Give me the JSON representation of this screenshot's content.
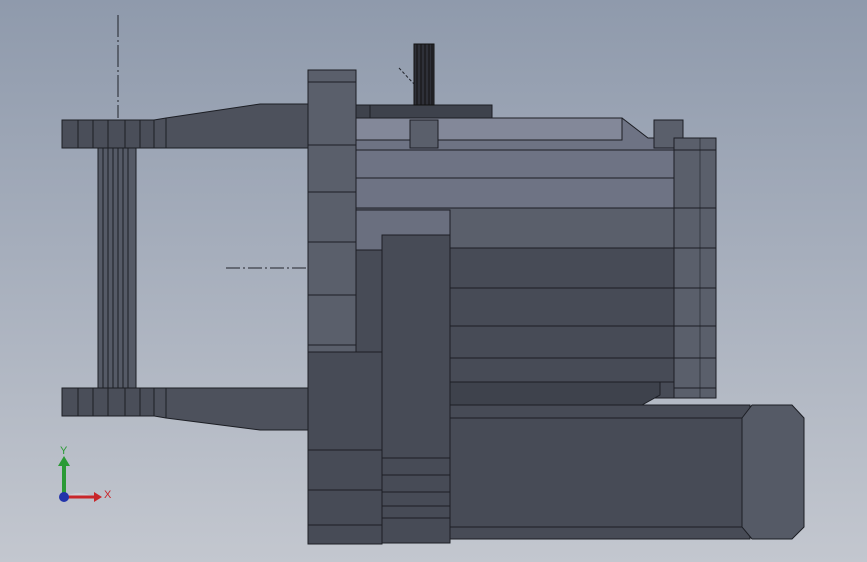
{
  "viewport": {
    "background_top": "#8f9aac",
    "background_bottom": "#c3c7cf"
  },
  "model": {
    "dark_color": "#474b56",
    "mid_color": "#5a5f6b",
    "light_color": "#7d8294",
    "edge_color": "#1c1e24",
    "centerline_color": "#20232a"
  },
  "triad": {
    "x_label": "X",
    "y_label": "Y",
    "x_color": "#c8262a",
    "y_color": "#2a9a35",
    "z_color": "#2233aa"
  }
}
